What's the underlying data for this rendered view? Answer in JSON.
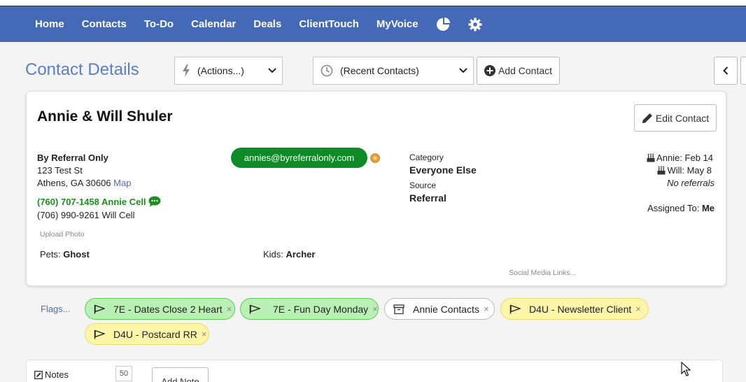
{
  "nav": {
    "items": [
      "Home",
      "Contacts",
      "To-Do",
      "Calendar",
      "Deals",
      "ClientTouch",
      "MyVoice"
    ],
    "icons": [
      "pie-chart-icon",
      "gear-icon"
    ]
  },
  "page": {
    "title": "Contact Details",
    "actions_label": "(Actions...)",
    "recent_label": "(Recent Contacts)",
    "add_contact_label": "Add Contact"
  },
  "contact": {
    "name": "Annie & Will Shuler",
    "edit_label": "Edit Contact",
    "company": "By Referral Only",
    "address1": "123 Test St",
    "address2": "Athens, GA 30606",
    "map_link": "Map",
    "phone1": "(760) 707-1458 Annie Cell",
    "phone2": "(706) 990-9261 Will Cell",
    "upload_photo": "Upload Photo",
    "email": "annies@byreferralonly.com",
    "category_label": "Category",
    "category_value": "Everyone Else",
    "source_label": "Source",
    "source_value": "Referral",
    "birthday1": "Annie: Feb 14",
    "birthday2": "Will: May 8",
    "referrals": "No referrals",
    "assigned_label": "Assigned To:",
    "assigned_value": "Me",
    "pets_label": "Pets:",
    "pets_value": "Ghost",
    "kids_label": "Kids:",
    "kids_value": "Archer",
    "social_link": "Social Media Links..."
  },
  "flags": {
    "label": "Flags...",
    "items": [
      {
        "label": "7E - Dates Close 2 Heart",
        "style": "green",
        "icon": "flag-icon"
      },
      {
        "label": "7E - Fun Day Monday",
        "style": "green",
        "icon": "flag-icon"
      },
      {
        "label": "Annie Contacts",
        "style": "white",
        "icon": "archive-icon"
      },
      {
        "label": "D4U - Newsletter Client",
        "style": "yellow",
        "icon": "flag-icon"
      },
      {
        "label": "D4U - Postcard RR",
        "style": "yellow",
        "icon": "flag-icon"
      }
    ],
    "remove_glyph": "×"
  },
  "notes": {
    "label": "Notes",
    "count": "50",
    "add_label": "Add Note"
  },
  "colors": {
    "nav_bg": "#4469b6",
    "title": "#5b7fc2",
    "email_pill": "#0e8a26",
    "green_flag": "#b9f0b3",
    "yellow_flag": "#fdf6a8"
  }
}
